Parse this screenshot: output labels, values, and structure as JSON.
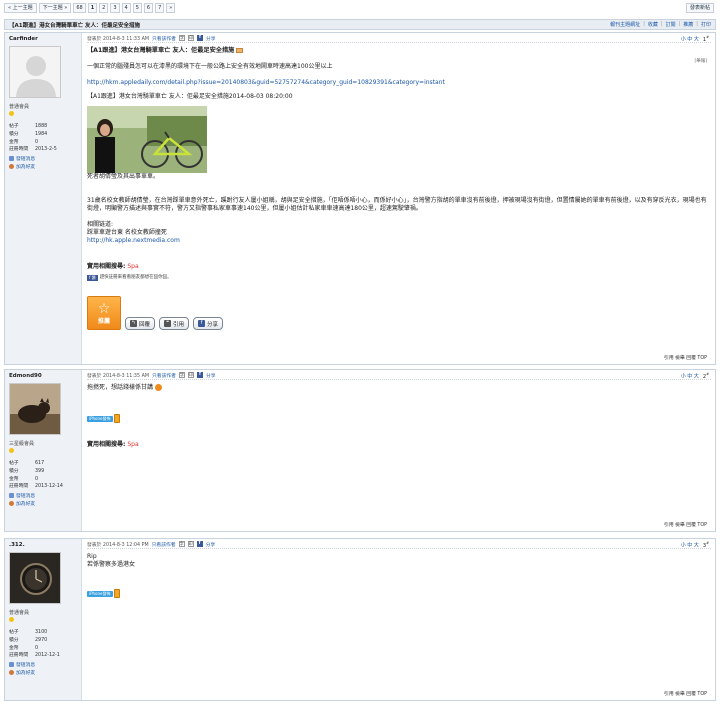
{
  "topbar": {
    "prev_label": "« 上一主題",
    "next_label": "下一主題 »",
    "page_count": "68",
    "pages": [
      "1",
      "2",
      "3",
      "4",
      "5",
      "6",
      "7"
    ],
    "next_pages": "»",
    "quick_reply": "發表新帖"
  },
  "thread": {
    "title": "【A1跟進】港女台灣騎單車亡 友人：佢最足安全措施",
    "tools": [
      "報刊主題網址",
      "收藏",
      "訂閱",
      "推薦",
      "打印"
    ]
  },
  "posts": [
    {
      "username": "Carfinder",
      "rank": "普通會員",
      "stats": [
        [
          "帖子",
          "1888"
        ],
        [
          "積分",
          "1984"
        ],
        [
          "金幣",
          "0"
        ],
        [
          "註冊時間",
          "2013-2-5"
        ]
      ],
      "send_msg": "發短消息",
      "add_friend": "加為好友",
      "posted": "發表於 2014-8-3 11:33 AM",
      "only_author": "只看該作者",
      "share": "分享",
      "fontsize": "小 中 大",
      "floor": "1",
      "title": "【A1跟進】港女台灣騎單車亡 友人：佢最足安全措施",
      "report": "[舉報]",
      "para1": "一個正常的腦殘員怎可以在漆黑的環境下在一般公路上安全有效地鬧車時速高達100公里以上",
      "url1": "http://hkm.appledaily.com/detail.php?issue=20140803&guid=52757274&category_guid=10829391&category=instant",
      "subtitle": "【A1跟進】港女台灣騎單車亡 友人：佢最足安全措施2014-08-03 08:20:00",
      "caption": "死者胡倩瑩及其出事單車。",
      "para2": "31歲名校女教師胡倩瑩，在台灣踩單車意外死亡，蹊跗行友人屢小姐稱，胡與足安全措施，「佢唔係唔小心，而係好小心」，台灣警方指胡的單車沒有前後燈，押被現場沒有街燈，但置情屬她的單車有前後燈，以及有穿反光衣，現場也有街燈，明顯警方描述與事實不符，警方又指警事私家車事速140公里，但屢小姐估計私家車車速高達180公里，超速駕駛肇禍。",
      "related_label": "相關链道:",
      "related_line": "踩單車遊台東 名校女教師撞死",
      "url2": "http://hk.apple.nextmedia.com",
      "practical_label": "實用相關搜尋:",
      "practical_link": "Spa",
      "fb_note": "趕快註冊來看看朋友都想在囧你囧。",
      "rec_label": "推薦",
      "reply_label": "回覆",
      "quote_label": "引用",
      "share_label": "分享",
      "footer": "引用 檢舉 回覆 TOP"
    },
    {
      "username": "Edmond90",
      "rank": "三星級會員",
      "stats": [
        [
          "帖子",
          "617"
        ],
        [
          "積分",
          "399"
        ],
        [
          "金幣",
          "0"
        ],
        [
          "註冊時間",
          "2013-12-14"
        ]
      ],
      "send_msg": "發短消息",
      "add_friend": "加為好友",
      "posted": "發表於 2014-8-3 11:35 AM",
      "only_author": "只看該作者",
      "share": "分享",
      "fontsize": "小 中 大",
      "floor": "2",
      "text": "拖撚死，想話錢樣係甘講",
      "iphone_tag": "iPhone發佈",
      "practical_label": "實用相關搜尋:",
      "practical_link": "Spa",
      "footer": "引用 檢舉 回覆 TOP"
    },
    {
      "username": ".312.",
      "rank": "普通會員",
      "stats": [
        [
          "帖子",
          "3100"
        ],
        [
          "積分",
          "2970"
        ],
        [
          "金幣",
          "0"
        ],
        [
          "註冊時間",
          "2012-12-1"
        ]
      ],
      "send_msg": "發短消息",
      "add_friend": "加為好友",
      "posted": "發表於 2014-8-3 12:04 PM",
      "only_author": "只看該作者",
      "share": "分享",
      "fontsize": "小 中 大",
      "floor": "3",
      "line1": "Rip",
      "line2": "若係警察多過港女",
      "iphone_tag": "iPhone發佈",
      "footer": "引用 檢舉 回覆 TOP"
    }
  ]
}
